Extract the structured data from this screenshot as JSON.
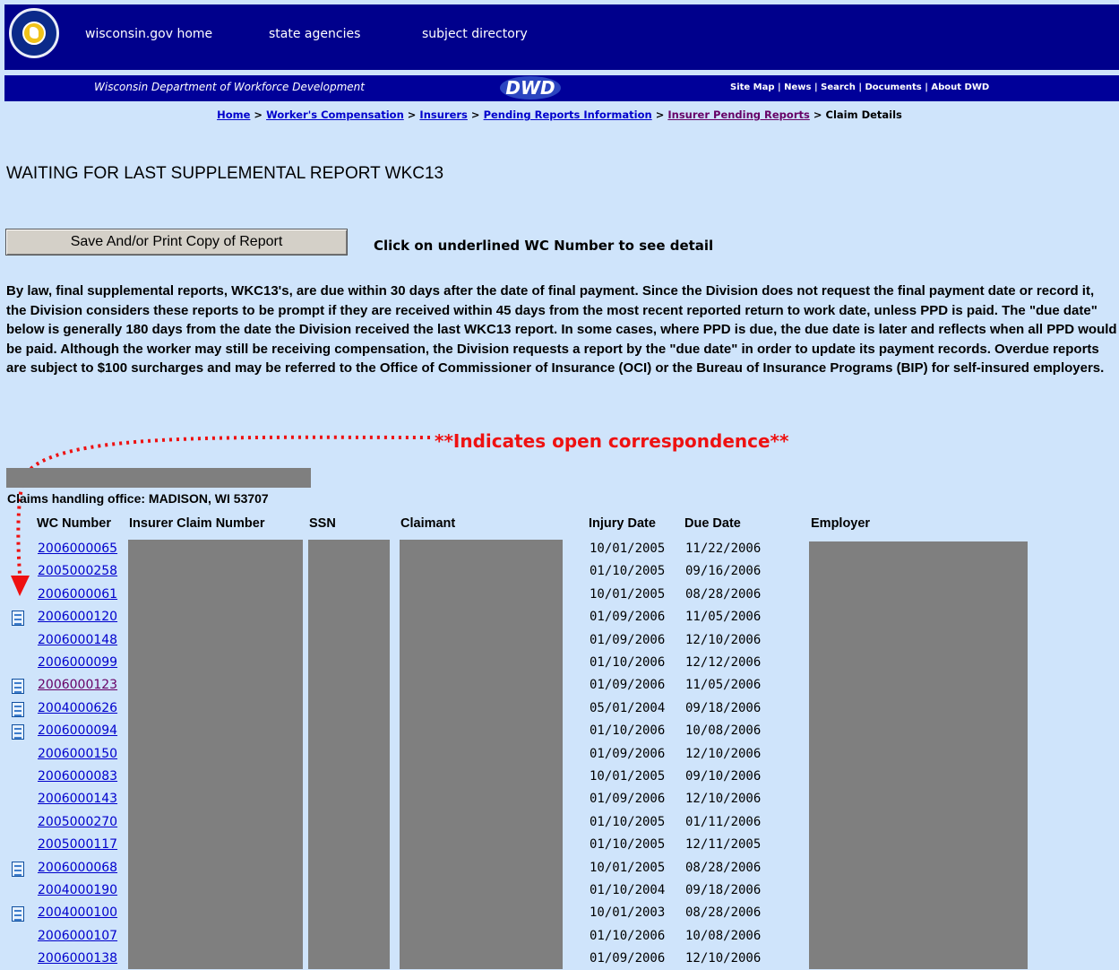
{
  "header": {
    "seal_alt": "WISCONSIN.GOV",
    "nav": [
      "wisconsin.gov home",
      "state agencies",
      "subject directory"
    ],
    "dept_name": "Wisconsin Department of Workforce Development",
    "logo_text": "DWD",
    "links": [
      "Site Map",
      "News",
      "Search",
      "Documents",
      "About DWD"
    ]
  },
  "breadcrumb": {
    "items": [
      "Home",
      "Worker's Compensation",
      "Insurers",
      "Pending Reports Information",
      "Insurer Pending Reports"
    ],
    "current": "Claim Details"
  },
  "page_title": "WAITING FOR LAST SUPPLEMENTAL REPORT WKC13",
  "save_button": "Save And/or Print Copy of Report",
  "click_note": "Click on underlined WC Number to see detail",
  "paragraph": "By law, final supplemental reports, WKC13's, are due within 30 days after the date of final payment.  Since the Division does not request the final payment date or record it, the Division considers these reports to be prompt if they are received within 45 days from the most recent reported return to work date, unless PPD is paid.  The \"due date\" below is generally 180 days from the date the Division received the last WKC13 report.   In some cases, where PPD is due, the due date is later and reflects when all PPD would be paid. Although the worker may still be receiving compensation, the Division requests a report by the \"due date\" in order to update its payment records. Overdue reports are subject to $100 surcharges and may be referred to the Office of Commissioner of Insurance (OCI) or the Bureau of Insurance Programs (BIP) for self-insured employers.",
  "correspondence_note": "**Indicates open correspondence**",
  "office": "Claims handling office: MADISON, WI  53707",
  "columns": [
    "WC Number",
    "Insurer Claim Number",
    "SSN",
    "Claimant",
    "Injury Date",
    "Due Date",
    "Employer"
  ],
  "rows": [
    {
      "wc": "2006000065",
      "injury": "10/01/2005",
      "due": "11/22/2006",
      "doc": false,
      "visited": false
    },
    {
      "wc": "2005000258",
      "injury": "01/10/2005",
      "due": "09/16/2006",
      "doc": false,
      "visited": false
    },
    {
      "wc": "2006000061",
      "injury": "10/01/2005",
      "due": "08/28/2006",
      "doc": false,
      "visited": false
    },
    {
      "wc": "2006000120",
      "injury": "01/09/2006",
      "due": "11/05/2006",
      "doc": true,
      "visited": false
    },
    {
      "wc": "2006000148",
      "injury": "01/09/2006",
      "due": "12/10/2006",
      "doc": false,
      "visited": false
    },
    {
      "wc": "2006000099",
      "injury": "01/10/2006",
      "due": "12/12/2006",
      "doc": false,
      "visited": false
    },
    {
      "wc": "2006000123",
      "injury": "01/09/2006",
      "due": "11/05/2006",
      "doc": true,
      "visited": true
    },
    {
      "wc": "2004000626",
      "injury": "05/01/2004",
      "due": "09/18/2006",
      "doc": true,
      "visited": false
    },
    {
      "wc": "2006000094",
      "injury": "01/10/2006",
      "due": "10/08/2006",
      "doc": true,
      "visited": false
    },
    {
      "wc": "2006000150",
      "injury": "01/09/2006",
      "due": "12/10/2006",
      "doc": false,
      "visited": false
    },
    {
      "wc": "2006000083",
      "injury": "10/01/2005",
      "due": "09/10/2006",
      "doc": false,
      "visited": false
    },
    {
      "wc": "2006000143",
      "injury": "01/09/2006",
      "due": "12/10/2006",
      "doc": false,
      "visited": false
    },
    {
      "wc": "2005000270",
      "injury": "01/10/2005",
      "due": "01/11/2006",
      "doc": false,
      "visited": false
    },
    {
      "wc": "2005000117",
      "injury": "01/10/2005",
      "due": "12/11/2005",
      "doc": false,
      "visited": false
    },
    {
      "wc": "2006000068",
      "injury": "10/01/2005",
      "due": "08/28/2006",
      "doc": true,
      "visited": false
    },
    {
      "wc": "2004000190",
      "injury": "01/10/2004",
      "due": "09/18/2006",
      "doc": false,
      "visited": false
    },
    {
      "wc": "2004000100",
      "injury": "10/01/2003",
      "due": "08/28/2006",
      "doc": true,
      "visited": false
    },
    {
      "wc": "2006000107",
      "injury": "01/10/2006",
      "due": "10/08/2006",
      "doc": false,
      "visited": false
    },
    {
      "wc": "2006000138",
      "injury": "01/09/2006",
      "due": "12/10/2006",
      "doc": false,
      "visited": false
    }
  ],
  "colors": {
    "banner": "#00008c",
    "page_bg": "#cfe4fb",
    "link": "#0000cc",
    "visited": "#660066",
    "alert": "#ee1111",
    "redaction": "#7f7f7f"
  }
}
